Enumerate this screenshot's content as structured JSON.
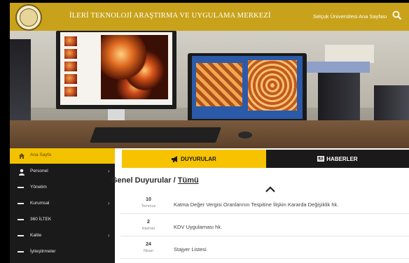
{
  "header": {
    "site_title": "İLERİ TEKNOLOJİ ARAŞTIRMA VE UYGULAMA MERKEZİ",
    "university_link": "Selçuk Üniversitesi Ana Sayfası",
    "logo_icon": "university-seal-logo",
    "search_icon": "search-icon",
    "colors": {
      "header_bg": "#c8a21a",
      "accent": "#f7c300",
      "sidebar_bg": "#1a1a1a"
    }
  },
  "sidebar": {
    "items": [
      {
        "label": "Ana Sayfa",
        "icon": "home-icon",
        "active": true,
        "has_submenu": false
      },
      {
        "label": "Personel",
        "icon": "user-icon",
        "active": false,
        "has_submenu": true
      },
      {
        "label": "Yönetim",
        "icon": "dash-icon",
        "active": false,
        "has_submenu": false
      },
      {
        "label": "Kurumsal",
        "icon": "dash-icon",
        "active": false,
        "has_submenu": true
      },
      {
        "label": "360 İLTEK",
        "icon": "dash-icon",
        "active": false,
        "has_submenu": false
      },
      {
        "label": "Kalite",
        "icon": "dash-icon",
        "active": false,
        "has_submenu": true
      },
      {
        "label": "İyileştirmeler",
        "icon": "dash-icon",
        "active": false,
        "has_submenu": false
      }
    ]
  },
  "tabs": [
    {
      "label": "DUYURULAR",
      "icon": "megaphone-icon",
      "active": true
    },
    {
      "label": "HABERLER",
      "icon": "newspaper-icon",
      "active": false
    }
  ],
  "section": {
    "heading": "Genel Duyurular / ",
    "all_link": "Tümü"
  },
  "announcements": [
    {
      "day": "10",
      "month": "Temmuz",
      "text": "Katma Değer Vergisi Oranlarının Tespitine İlişkin Kararda Değişiklik hk."
    },
    {
      "day": "2",
      "month": "Haziran",
      "text": "KDV Uygulaması hk."
    },
    {
      "day": "24",
      "month": "Nisan",
      "text": "Stajyer Listesi"
    }
  ]
}
